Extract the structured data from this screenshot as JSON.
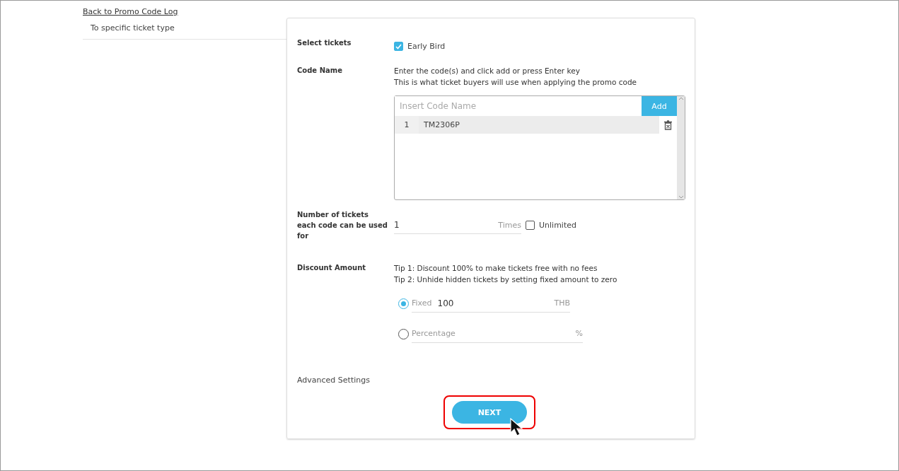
{
  "back_link": "Back to Promo Code Log",
  "sidebar": {
    "item": "To specific ticket type"
  },
  "select_tickets": {
    "label": "Select tickets",
    "tickets": [
      {
        "name": "Early Bird",
        "checked": true
      }
    ]
  },
  "code_name": {
    "label": "Code Name",
    "hints": [
      "Enter the code(s) and click add or press Enter key",
      "This is what ticket buyers will use when applying the promo code"
    ],
    "placeholder": "Insert Code Name",
    "add_button": "Add",
    "codes": [
      {
        "index": "1",
        "code": "TM2306P"
      }
    ]
  },
  "uses": {
    "label": "Number of tickets each code can be used for",
    "value": "1",
    "unit": "Times",
    "unlimited": {
      "label": "Unlimited",
      "checked": false
    }
  },
  "discount": {
    "label": "Discount Amount",
    "tips": [
      "Tip 1: Discount 100% to make tickets free with no fees",
      "Tip 2: Unhide hidden tickets by setting fixed amount to zero"
    ],
    "options": [
      {
        "label": "Fixed",
        "value": "100",
        "unit": "THB",
        "selected": true
      },
      {
        "label": "Percentage",
        "unit": "%",
        "selected": false
      }
    ]
  },
  "advanced": "Advanced Settings",
  "next_button": "NEXT"
}
